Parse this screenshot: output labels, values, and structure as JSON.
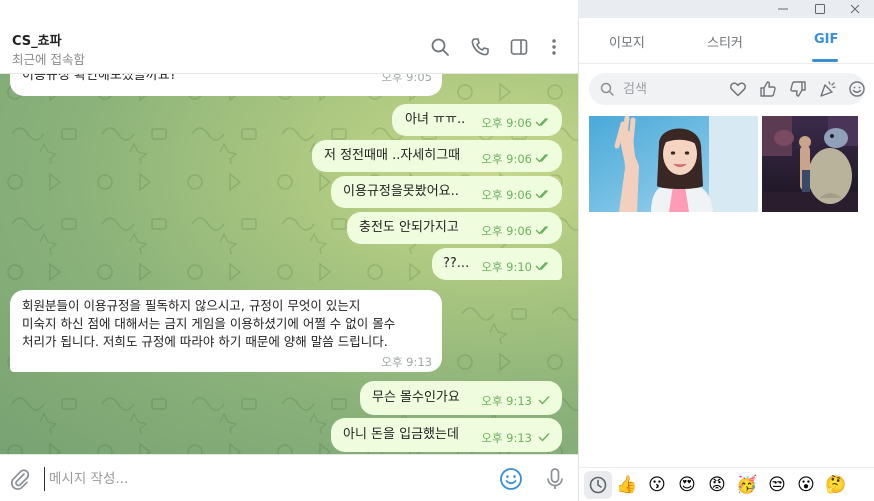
{
  "chat": {
    "title": "CS_쵸파",
    "status": "최근에 접속함"
  },
  "messages": [
    {
      "dir": "in",
      "text": "이용규정 확인해보셨을까요?",
      "time": "오후 9:05"
    },
    {
      "dir": "out",
      "text": "아녀 ㅠㅠ..",
      "time": "오후 9:06"
    },
    {
      "dir": "out",
      "text": "저 정전때매 ..자세히그때",
      "time": "오후 9:06"
    },
    {
      "dir": "out",
      "text": "이용규정을못봤어요..",
      "time": "오후 9:06"
    },
    {
      "dir": "out",
      "text": "충전도 안되가지고",
      "time": "오후 9:06"
    },
    {
      "dir": "out",
      "text": "??...",
      "time": "오후 9:10"
    },
    {
      "dir": "in",
      "lines": [
        "회원분들이 이용규정을 필독하지 않으시고, 규정이 무엇이 있는지",
        "미숙지 하신 점에 대해서는 금지 게임을 이용하셨기에 어쩔 수 없이 몰수",
        "처리가 됩니다. 저희도 규정에 따라야 하기 때문에 양해 말씀 드립니다."
      ],
      "time": "오후 9:13"
    },
    {
      "dir": "out",
      "text": "무슨 몰수인가요",
      "time": "오후 9:13"
    },
    {
      "dir": "out",
      "text": "아니 돈을 입금했는데",
      "time": "오후 9:13"
    }
  ],
  "composer": {
    "placeholder": "메시지 작성..."
  },
  "panel": {
    "tabs": [
      "이모지",
      "스티커",
      "GIF"
    ],
    "active_tab": "GIF",
    "search_placeholder": "검색",
    "emoji_bar": [
      "👍",
      "😗",
      "😍",
      "😡",
      "🥳",
      "😒",
      "😮",
      "🤔"
    ]
  },
  "colors": {
    "accent": "#3a8fd8",
    "outgoing_bubble": "#effdde",
    "incoming_bubble": "#ffffff",
    "outgoing_time": "#6cb15c"
  }
}
